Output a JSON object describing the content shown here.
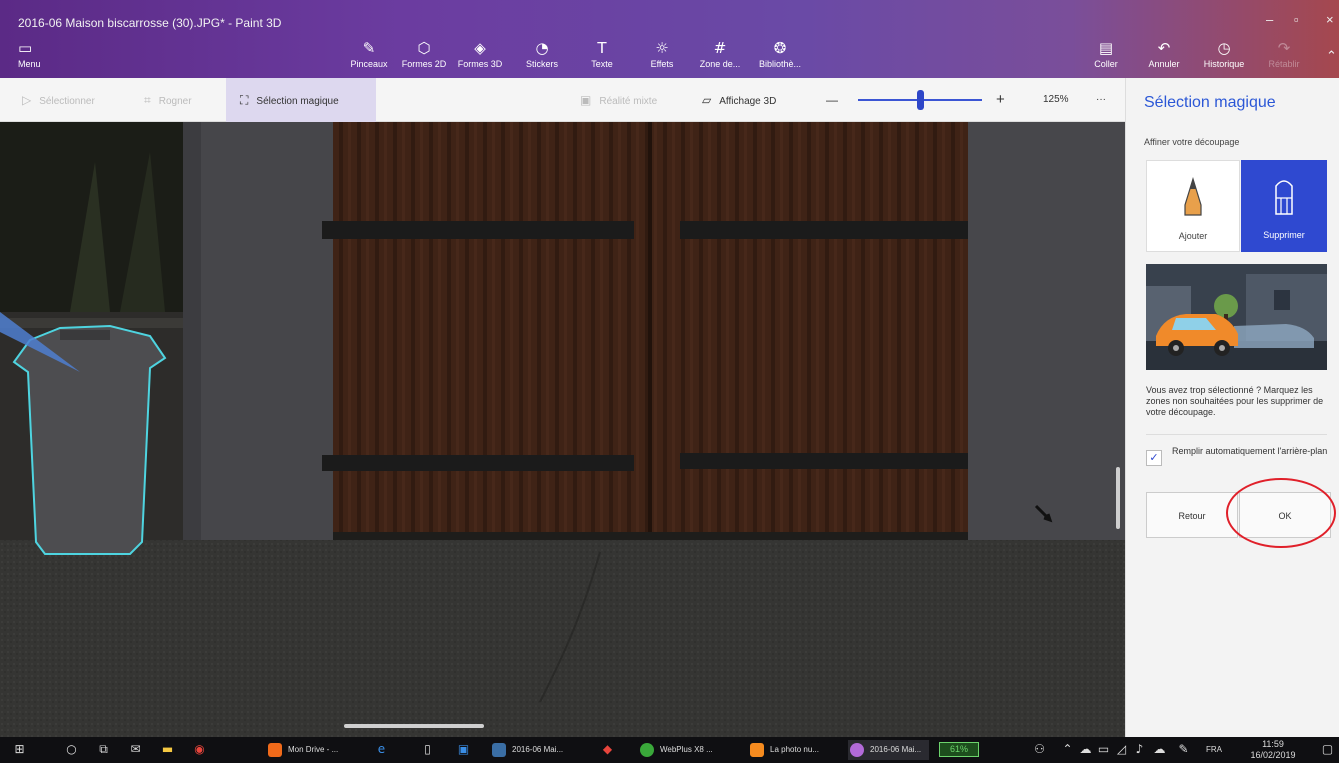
{
  "window": {
    "title": "2016-06 Maison biscarrosse (30).JPG* - Paint 3D",
    "minimize_glyph": "–",
    "maximize_glyph": "▫",
    "close_glyph": "×"
  },
  "ribbon": {
    "menu": "Menu",
    "tools": [
      "Pinceaux",
      "Formes 2D",
      "Formes 3D",
      "Stickers",
      "Texte",
      "Effets",
      "Zone de...",
      "Bibliothè..."
    ],
    "coller": "Coller",
    "annuler": "Annuler",
    "historique": "Historique",
    "retablir": "Rétablir"
  },
  "toolbar": {
    "selectionner": "Sélectionner",
    "rogner": "Rogner",
    "selection_magique": "Sélection magique",
    "realite_mixte": "Réalité mixte",
    "affichage_3d": "Affichage 3D",
    "zoom_minus": "—",
    "zoom_plus": "+",
    "zoom_level": "125%",
    "zoom_fraction": 0.5,
    "more": "···"
  },
  "panel": {
    "title": "Sélection magique",
    "subtitle": "Affiner votre découpage",
    "mode_add": "Ajouter",
    "mode_remove": "Supprimer",
    "description": "Vous avez trop sélectionné ? Marquez les zones non souhaitées pour les supprimer de votre découpage.",
    "autofill_checked": true,
    "autofill_label": "Remplir automatiquement l'arrière-plan",
    "back": "Retour",
    "ok": "OK"
  },
  "taskbar": {
    "apps": [
      {
        "label": "Mon Drive - ...",
        "color": "#f06a1a"
      },
      {
        "label": "2016-06 Mai...",
        "color": "#3a6ea5"
      },
      {
        "label": "WebPlus X8 ...",
        "color": "#3aa83a"
      },
      {
        "label": "La photo nu...",
        "color": "#f58b1f"
      },
      {
        "label": "2016-06 Mai...",
        "color": "#b26ad8"
      }
    ],
    "battery": "61%",
    "language": "FRA",
    "time": "11:59",
    "date": "16/02/2019"
  },
  "colors": {
    "accent": "#2f49d0",
    "highlight_ring": "#e0202a",
    "selection_outline": "#4ed4e0"
  }
}
